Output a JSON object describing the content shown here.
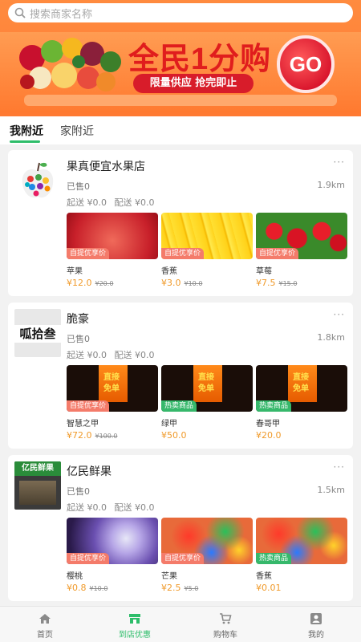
{
  "search": {
    "placeholder": "搜索商家名称"
  },
  "banner": {
    "title": "全民1分购",
    "subtitle": "限量供应 抢完即止",
    "go_label": "GO"
  },
  "tabs": [
    {
      "label": "我附近"
    },
    {
      "label": "家附近"
    }
  ],
  "shops": [
    {
      "name": "果真便宜水果店",
      "more": "···",
      "sold": "已售0",
      "distance": "1.9km",
      "delivery_start": "起送 ¥0.0",
      "delivery_fee": "配送 ¥0.0",
      "products": [
        {
          "name": "苹果",
          "tag": "自提优享价",
          "price": "¥12.0",
          "old_price": "¥20.0"
        },
        {
          "name": "香蕉",
          "tag": "自提优享价",
          "price": "¥3.0",
          "old_price": "¥10.0"
        },
        {
          "name": "草莓",
          "tag": "自提优享价",
          "price": "¥7.5",
          "old_price": "¥15.0"
        }
      ]
    },
    {
      "name": "脆豪",
      "more": "···",
      "sold": "已售0",
      "distance": "1.8km",
      "delivery_start": "起送 ¥0.0",
      "delivery_fee": "配送 ¥0.0",
      "logo_text": "呱拾叁",
      "products": [
        {
          "name": "智慧之甲",
          "tag": "自提优享价",
          "price": "¥72.0",
          "old_price": "¥100.0"
        },
        {
          "name": "绿甲",
          "tag": "热卖商品",
          "price": "¥50.0",
          "old_price": ""
        },
        {
          "name": "春哥甲",
          "tag": "热卖商品",
          "price": "¥20.0",
          "old_price": ""
        }
      ]
    },
    {
      "name": "亿民鲜果",
      "more": "···",
      "sold": "已售0",
      "distance": "1.5km",
      "delivery_start": "起送 ¥0.0",
      "delivery_fee": "配送 ¥0.0",
      "logo_text": "亿民鲜果",
      "products": [
        {
          "name": "樱桃",
          "tag": "自提优享价",
          "price": "¥0.8",
          "old_price": "¥10.0"
        },
        {
          "name": "芒果",
          "tag": "自提优享价",
          "price": "¥2.5",
          "old_price": "¥5.0"
        },
        {
          "name": "香蕉",
          "tag": "热卖商品",
          "price": "¥0.01",
          "old_price": ""
        }
      ]
    }
  ],
  "promo_poster": {
    "line1": "直接",
    "line2": "免单"
  },
  "nav": [
    {
      "label": "首页",
      "icon": "home-icon"
    },
    {
      "label": "到店优惠",
      "icon": "store-icon"
    },
    {
      "label": "购物车",
      "icon": "cart-icon"
    },
    {
      "label": "我的",
      "icon": "profile-icon"
    }
  ],
  "colors": {
    "accent": "#2ebd6a",
    "header": "#ff7a32",
    "price": "#f09a2a",
    "discount_tag": "#f47b6a",
    "hot_tag": "#36b86b"
  }
}
